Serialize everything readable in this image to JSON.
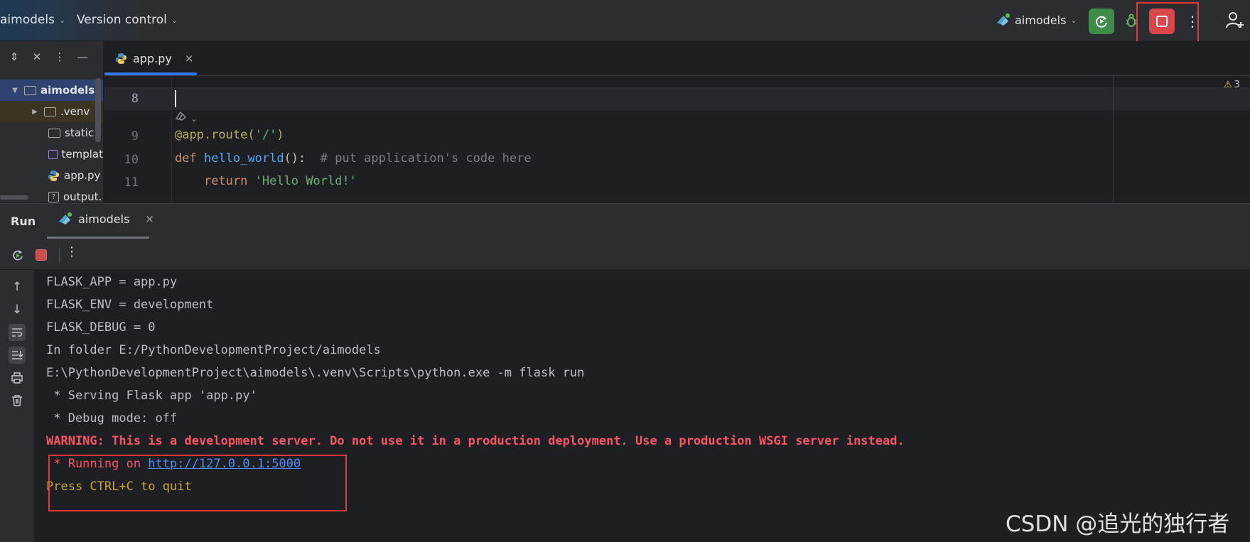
{
  "titlebar": {
    "project_menu": "aimodels",
    "vcs_menu": "Version control",
    "run_config": "aimodels",
    "more_glyph": "⋮"
  },
  "project_tree": {
    "tool_glyphs": [
      "⇕",
      "✕",
      "⋮",
      "—"
    ],
    "items": [
      {
        "label": "aimodels",
        "kind": "root"
      },
      {
        "label": ".venv",
        "kind": "folder"
      },
      {
        "label": "static",
        "kind": "folder"
      },
      {
        "label": "templat",
        "kind": "folder-purple"
      },
      {
        "label": "app.py",
        "kind": "python"
      },
      {
        "label": "output.",
        "kind": "unknown"
      }
    ]
  },
  "editor": {
    "tab_label": "app.py",
    "close_glyph": "×",
    "warning_count": "3",
    "lines": {
      "l8": "8",
      "l9": "9",
      "l10": "10",
      "l11": "11"
    },
    "code": {
      "l9_decorator": "@app.route(",
      "l9_string": "'/'",
      "l9_close": ")",
      "l10_kw": "def",
      "l10_fn": "hello_world",
      "l10_rest": "():  ",
      "l10_comment": "# put application's code here",
      "l11_kw": "return",
      "l11_string": "'Hello World!'"
    }
  },
  "run_panel": {
    "title": "Run",
    "tab_label": "aimodels",
    "close_glyph": "×",
    "more_glyph": "⋮",
    "console": {
      "line1": "FLASK_APP = app.py",
      "line2": "FLASK_ENV = development",
      "line3": "FLASK_DEBUG = 0",
      "line4": "In folder E:/PythonDevelopmentProject/aimodels",
      "line5": "E:\\PythonDevelopmentProject\\aimodels\\.venv\\Scripts\\python.exe -m flask run",
      "line6": " * Serving Flask app 'app.py'",
      "line7": " * Debug mode: off",
      "warning": "WARNING: This is a development server. Do not use it in a production deployment. Use a production WSGI server instead.",
      "running_prefix": " * Running on ",
      "running_url": "http://127.0.0.1:5000",
      "quit_hint": "Press CTRL+C to quit"
    }
  },
  "watermark": "CSDN @追光的独行者",
  "colors": {
    "accent": "#3574f0",
    "stop_red": "#d9474a",
    "run_green": "#3e8b4a",
    "highlight_box": "#e53935"
  }
}
